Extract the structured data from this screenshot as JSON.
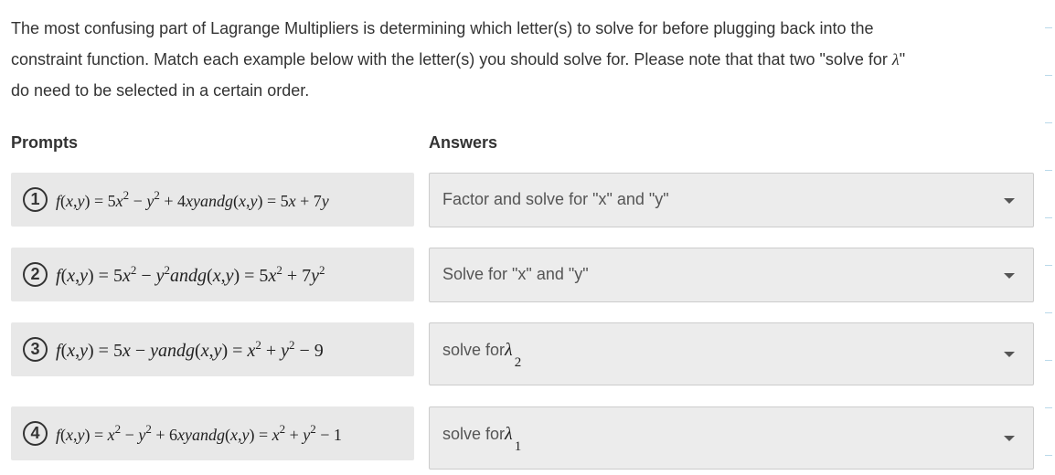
{
  "instructions": {
    "line1": "The most confusing part of Lagrange Multipliers is determining which letter(s) to solve for before plugging back into the",
    "line2_pre": "constraint function. Match each example below with the letter(s) you should solve for. Please note that that two \"solve for ",
    "lambda": "λ",
    "line2_post": "\"",
    "line3": "do need to be selected in a certain order."
  },
  "columns": {
    "prompts": "Prompts",
    "answers": "Answers"
  },
  "prompts": [
    {
      "number": "1",
      "expr": "f(x,y) = 5x² − y² + 4xyandg(x,y) = 5x + 7y"
    },
    {
      "number": "2",
      "expr": "f(x,y) = 5x² − y²andg(x,y) = 5x² + 7y²"
    },
    {
      "number": "3",
      "expr": "f(x,y) = 5x − yandg(x,y) = x² + y² − 9"
    },
    {
      "number": "4",
      "expr": "f(x,y) = x² − y² + 6xyandg(x,y) = x² + y² − 1"
    }
  ],
  "answers": [
    {
      "text": "Factor and solve for \"x\" and \"y\""
    },
    {
      "text": "Solve for \"x\" and \"y\""
    },
    {
      "text": "solve for",
      "symbol": "λ",
      "subscript": "2"
    },
    {
      "text": "solve for",
      "symbol": "λ",
      "subscript": "1"
    }
  ],
  "icons": {
    "dropdown": "chevron-down-icon"
  },
  "colors": {
    "prompt_bg": "#e8e8e8",
    "answer_bg": "#ececec",
    "text": "#333333",
    "edge_mark": "#b9d9ea"
  }
}
